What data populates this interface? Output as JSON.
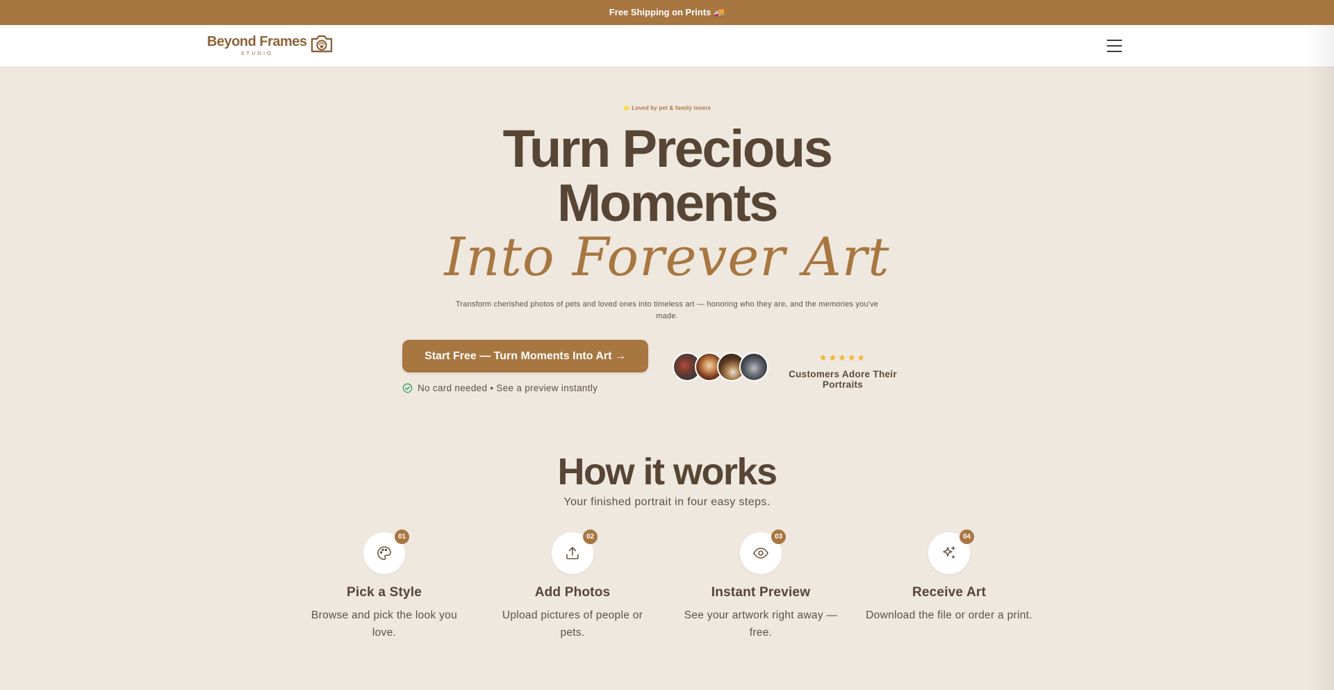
{
  "announcement": {
    "text": "Free Shipping on Prints 🚚"
  },
  "nav": {
    "logo_main": "Beyond Frames",
    "logo_sub": "STUDIO",
    "menu_icon": "hamburger-menu-icon"
  },
  "hero": {
    "badge": "⭐ Loved by pet & family lovers",
    "title_line1": "Turn Precious",
    "title_line2": "Moments",
    "title_italic": "Into Forever Art",
    "subtitle": "Transform cherished photos of pets and loved ones into timeless art — honoring who they are, and the memories you've made.",
    "cta_label": "Start Free — Turn Moments Into Art →",
    "cta_note": "No card needed • See a preview instantly",
    "rating_stars": "★★★★★",
    "rating_label": "Customers Adore Their Portraits"
  },
  "how": {
    "title": "How it works",
    "subtitle": "Your finished portrait in four easy steps.",
    "steps": [
      {
        "num": "01",
        "icon": "palette-icon",
        "title": "Pick a Style",
        "desc": "Browse and pick the look you love."
      },
      {
        "num": "02",
        "icon": "upload-icon",
        "title": "Add Photos",
        "desc": "Upload pictures of people or pets."
      },
      {
        "num": "03",
        "icon": "eye-icon",
        "title": "Instant Preview",
        "desc": "See your artwork right away — free."
      },
      {
        "num": "04",
        "icon": "sparkles-icon",
        "title": "Receive Art",
        "desc": "Download the file or order a print."
      }
    ]
  },
  "colors": {
    "brand": "#a87640",
    "background": "#efe8df",
    "heading": "#574535",
    "star": "#f0b429",
    "check": "#2e9e5b"
  }
}
